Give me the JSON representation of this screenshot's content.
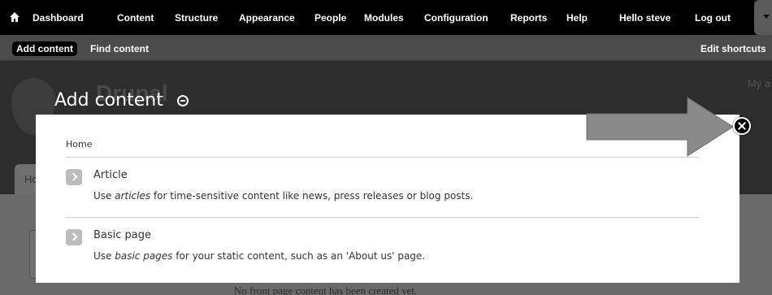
{
  "toolbar": {
    "home_icon": "home-icon",
    "items": [
      {
        "label": "Dashboard"
      },
      {
        "label": "Content"
      },
      {
        "label": "Structure"
      },
      {
        "label": "Appearance"
      },
      {
        "label": "People"
      },
      {
        "label": "Modules"
      },
      {
        "label": "Configuration"
      },
      {
        "label": "Reports"
      },
      {
        "label": "Help"
      }
    ],
    "greeting_prefix": "Hello",
    "username": "steve",
    "logout": "Log out",
    "toggle_icon": "chevron-down-icon"
  },
  "shortcuts": {
    "items": [
      {
        "label": "Add content",
        "active": true
      },
      {
        "label": "Find content",
        "active": false
      }
    ],
    "edit_label": "Edit shortcuts"
  },
  "background": {
    "site_name": "Drupal",
    "secondary_link": "My a",
    "tab_label": "Ho",
    "front_message": "No front page content has been created yet."
  },
  "overlay": {
    "title": "Add content",
    "breadcrumb": "Home",
    "items": [
      {
        "title": "Article",
        "desc_pre": "Use ",
        "desc_em": "articles",
        "desc_post": " for time-sensitive content like news, press releases or blog posts."
      },
      {
        "title": "Basic page",
        "desc_pre": "Use ",
        "desc_em": "basic pages",
        "desc_post": " for your static content, such as an 'About us' page."
      }
    ]
  },
  "colors": {
    "toolbar_bg": "#000000",
    "shortcut_bar_bg": "#4b4b4b",
    "dialog_bg": "#ffffff",
    "arrow": "#8a8a8a"
  }
}
